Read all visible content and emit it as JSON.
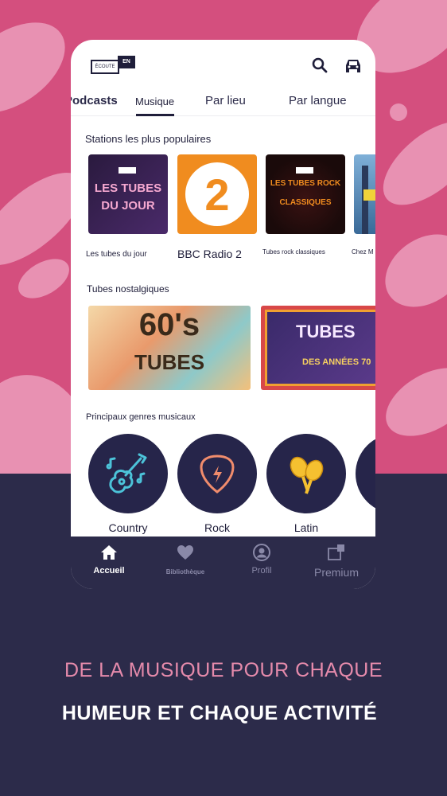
{
  "app": {
    "logo_small": "ÉCOUTE",
    "logo_badge": "EN"
  },
  "topbar": {
    "search_icon": "search-icon",
    "car_icon": "car-icon"
  },
  "tabs": [
    {
      "label": "Podcasts",
      "active": false
    },
    {
      "label": "Musique",
      "active": true
    },
    {
      "label": "Par lieu",
      "active": false
    },
    {
      "label": "Par langue",
      "active": false
    }
  ],
  "popular": {
    "title": "Stations les plus populaires",
    "items": [
      {
        "art_text_1": "LES TUBES",
        "art_text_2": "DU JOUR",
        "label": "Les tubes du jour"
      },
      {
        "art_text_1": "2",
        "label": "BBC Radio 2"
      },
      {
        "art_text_1": "LES TUBES ROCK",
        "art_text_2": "CLASSIQUES",
        "label": "Tubes rock classiques"
      },
      {
        "label": "Chez M"
      }
    ]
  },
  "nostalgic": {
    "title": "Tubes nostalgiques",
    "items": [
      {
        "art_text_1": "60's",
        "art_text_2": "TUBES"
      },
      {
        "art_text_1": "TUBES",
        "art_text_2": "DES ANNÉES 70"
      }
    ]
  },
  "genres": {
    "title": "Principaux genres musicaux",
    "items": [
      {
        "label": "Country",
        "icon": "guitar-icon"
      },
      {
        "label": "Rock",
        "icon": "guitar-pick-icon"
      },
      {
        "label": "Latin",
        "icon": "maracas-icon"
      }
    ]
  },
  "bottom_nav": [
    {
      "label": "Accueil",
      "icon": "home-icon",
      "active": true
    },
    {
      "label": "Bibliothèque",
      "icon": "heart-icon",
      "active": false
    },
    {
      "label": "Profil",
      "icon": "profile-icon",
      "active": false
    },
    {
      "label": "Premium",
      "icon": "premium-icon",
      "active": false
    }
  ],
  "headline": {
    "line1": "DE LA MUSIQUE POUR CHAQUE",
    "line2": "HUMEUR ET CHAQUE ACTIVITÉ"
  },
  "colors": {
    "brand_pink": "#d44f7e",
    "navy": "#2c2b4a",
    "accent_pink": "#e58aab",
    "genre_icon": "#4cc3d9",
    "bbc_orange": "#f08c1f"
  }
}
